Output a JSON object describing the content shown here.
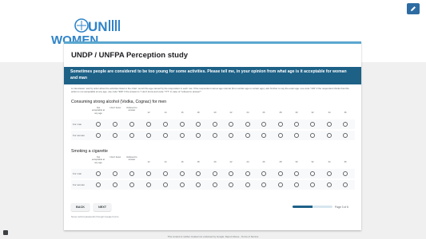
{
  "logo": {
    "text": "UN WOMEN"
  },
  "form": {
    "title": "UNDP / UNFPA Perception study",
    "section_header": "Sometimes people are considered to be too young for some activities. Please tell me, in your opinion from what age is it acceptable for woman and man",
    "section_desc": "to interviewer: ask by order about the activities listed in the chart: record the age named by the respondent in each row. If the respondent names age interval (from certain age to certain age), ask him/her to say the exact age. use code \"333\" if the respondent thinks that this action is not acceptable at any age. use code \"999\" if the answer is \"I don't know and code \"777\" in case of \"refused to answer\"\""
  },
  "columns": [
    "Not acceptable at any age",
    "I don't know",
    "Refused to answer",
    "12",
    "14",
    "16",
    "18",
    "20",
    "22",
    "24",
    "26",
    "28",
    "30",
    "32",
    "34",
    "36"
  ],
  "questions": [
    {
      "title": "Consuming strong alcohol (Vodka, Cognac) for men",
      "rows": [
        "For man",
        "For woman"
      ]
    },
    {
      "title": "Smoking a cigarette",
      "rows": [
        "For man",
        "For woman"
      ]
    }
  ],
  "nav": {
    "back_label": "BACK",
    "next_label": "NEXT"
  },
  "progress": {
    "text": "Page 3 of 6",
    "fraction": 0.5
  },
  "never_submit": "Never submit passwords through Google Forms.",
  "footer": "This content is neither created nor endorsed by Google. Report Abuse - Terms of Service",
  "colors": {
    "header": "#1d6187",
    "accent": "#5aa7cf",
    "logo": "#2f84c8"
  },
  "icons": {
    "edit": "pencil-icon",
    "report": "report-icon"
  }
}
